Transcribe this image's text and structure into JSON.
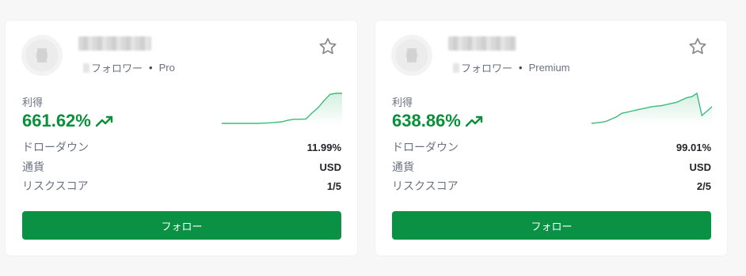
{
  "colors": {
    "accent_green": "#0a9144",
    "profit_green": "#0a8f3a",
    "sparkline": "#3dbb79"
  },
  "cards": [
    {
      "followers_label": "フォロワー",
      "tier": "Pro",
      "profit_label": "利得",
      "profit_value": "661.62%",
      "sparkline": [
        2,
        2,
        2,
        2,
        2,
        2,
        2,
        2.2,
        2.5,
        3,
        3.5,
        5,
        6,
        6,
        6.3,
        12,
        17,
        24,
        30,
        31,
        31
      ],
      "stats": [
        {
          "label": "ドローダウン",
          "value": "11.99%"
        },
        {
          "label": "通貨",
          "value": "USD"
        },
        {
          "label": "リスクスコア",
          "value": "1/5"
        }
      ],
      "follow_label": "フォロー",
      "icons": {
        "favorite": "star-outline-icon",
        "trend": "trending-up-icon"
      }
    },
    {
      "followers_label": "フォロワー",
      "tier": "Premium",
      "profit_label": "利得",
      "profit_value": "638.86%",
      "sparkline": [
        1,
        1.5,
        2,
        3,
        5,
        7,
        10,
        11,
        12,
        13,
        14,
        15,
        16,
        16.5,
        17,
        18,
        19,
        20,
        22,
        24,
        25,
        28,
        8,
        12,
        16
      ],
      "stats": [
        {
          "label": "ドローダウン",
          "value": "99.01%"
        },
        {
          "label": "通貨",
          "value": "USD"
        },
        {
          "label": "リスクスコア",
          "value": "2/5"
        }
      ],
      "follow_label": "フォロー",
      "icons": {
        "favorite": "star-outline-icon",
        "trend": "trending-up-icon"
      }
    }
  ]
}
